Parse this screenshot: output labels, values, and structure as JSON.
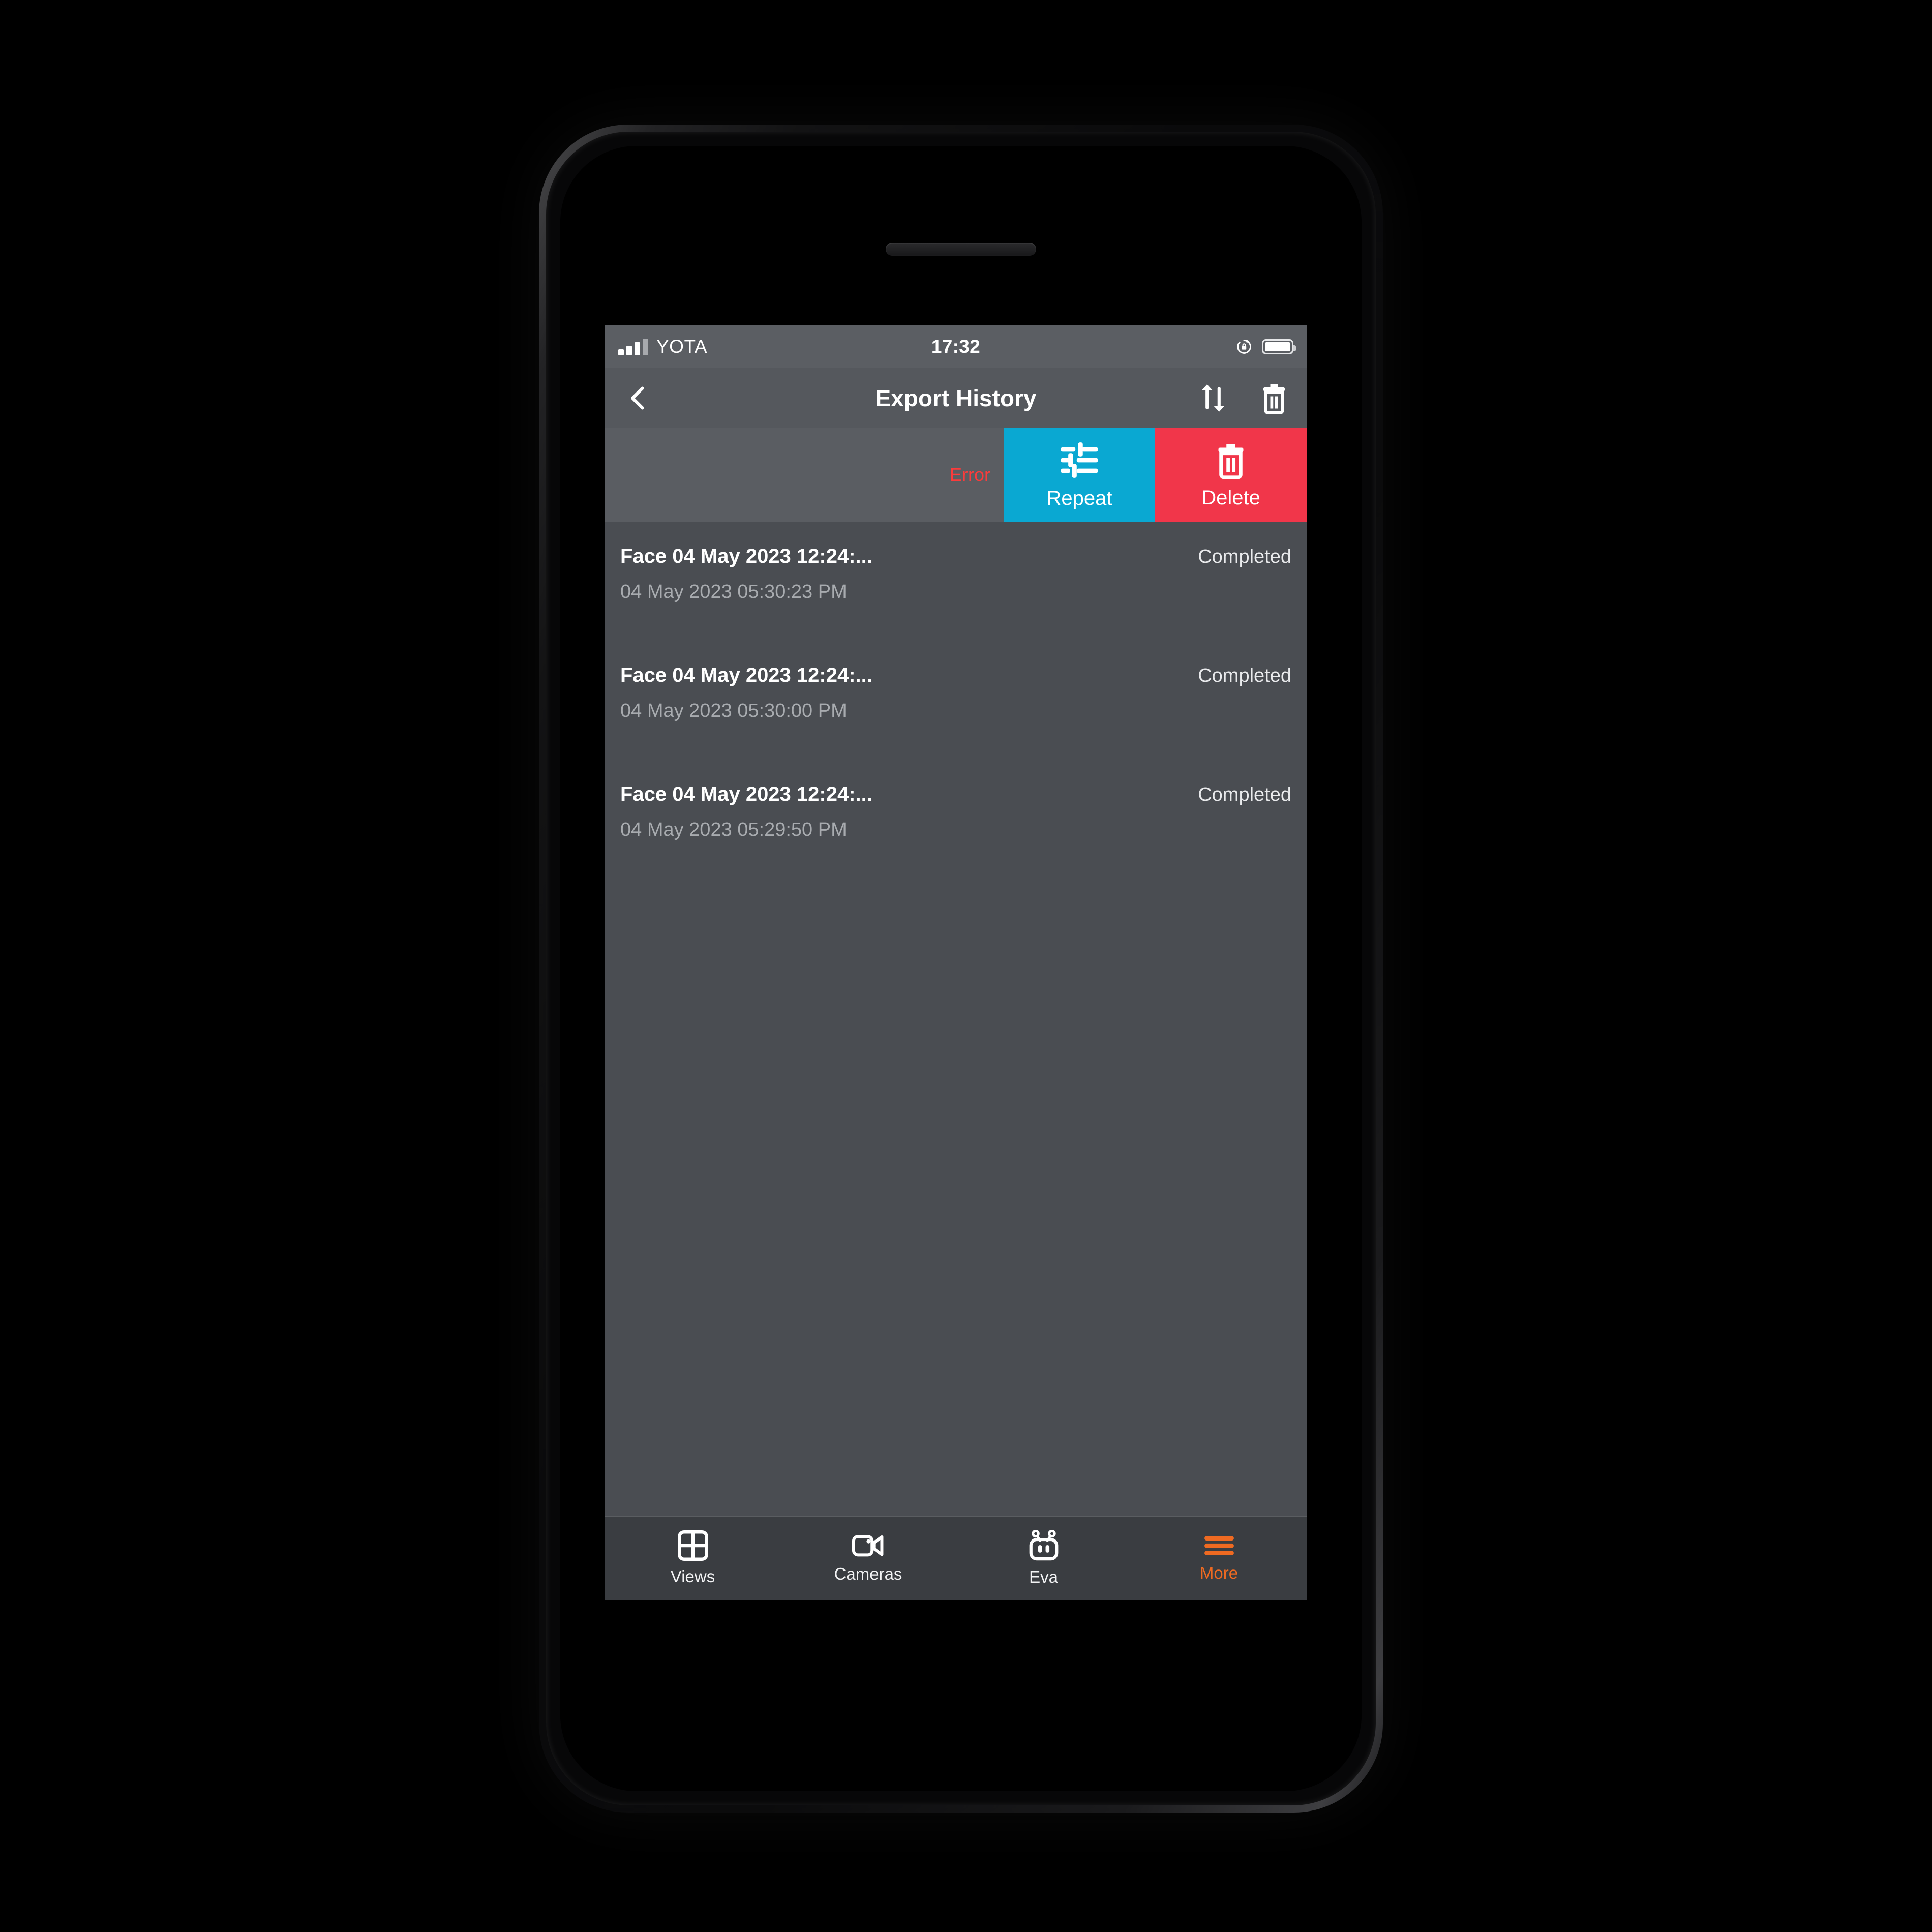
{
  "status_bar": {
    "carrier": "YOTA",
    "time": "17:32",
    "signal_bars_filled": 3,
    "signal_bars_total": 4,
    "rotation_lock_icon": "rotation-lock-icon",
    "battery_icon": "battery-full-icon",
    "battery_level_percent": 100
  },
  "nav_bar": {
    "back_icon": "chevron-left-icon",
    "title": "Export History",
    "sort_icon": "sort-arrows-icon",
    "delete_icon": "trash-icon"
  },
  "swiped_row": {
    "status_label": "Error",
    "status_color": "#fc3b3b",
    "actions": [
      {
        "label": "Repeat",
        "icon": "sliders-icon",
        "color": "#0aa8d2"
      },
      {
        "label": "Delete",
        "icon": "trash-icon",
        "color": "#f1364a"
      }
    ]
  },
  "list": {
    "rows": [
      {
        "title": "Face 04 May 2023 12:24:...",
        "status": "Completed",
        "subtitle": "04 May 2023 05:30:23 PM"
      },
      {
        "title": "Face 04 May 2023 12:24:...",
        "status": "Completed",
        "subtitle": "04 May 2023 05:30:00 PM"
      },
      {
        "title": "Face 04 May 2023 12:24:...",
        "status": "Completed",
        "subtitle": "04 May 2023 05:29:50 PM"
      }
    ]
  },
  "tab_bar": {
    "active_color": "#ef6a21",
    "tabs": [
      {
        "label": "Views",
        "icon": "grid-icon",
        "active": false
      },
      {
        "label": "Cameras",
        "icon": "video-camera-icon",
        "active": false
      },
      {
        "label": "Eva",
        "icon": "robot-icon",
        "active": false
      },
      {
        "label": "More",
        "icon": "hamburger-menu-icon",
        "active": true
      }
    ]
  }
}
